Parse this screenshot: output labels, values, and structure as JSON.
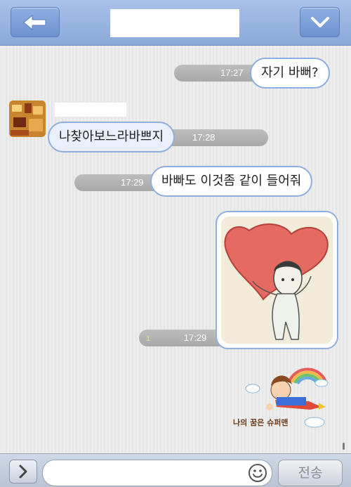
{
  "header": {
    "back_icon": "back-arrow-icon",
    "menu_icon": "chevron-down-icon",
    "title": ""
  },
  "messages": [
    {
      "direction": "out",
      "text": "자기 바뻐?",
      "time": "17:27"
    },
    {
      "direction": "in",
      "text": "나찾아보느라바쁘지",
      "time": "17:28"
    },
    {
      "direction": "out",
      "text": "바빠도 이것좀 같이 들어줘",
      "time": "17:29"
    },
    {
      "direction": "out",
      "type": "image",
      "time": "17:29",
      "unread": "1"
    }
  ],
  "sticker": {
    "caption": "나의 꿈은 슈퍼맨"
  },
  "input": {
    "placeholder": "",
    "send_label": "전송"
  },
  "colors": {
    "header": "#8aa8d9",
    "bubble_border": "#8eaee0",
    "unread": "#e8e86a"
  }
}
